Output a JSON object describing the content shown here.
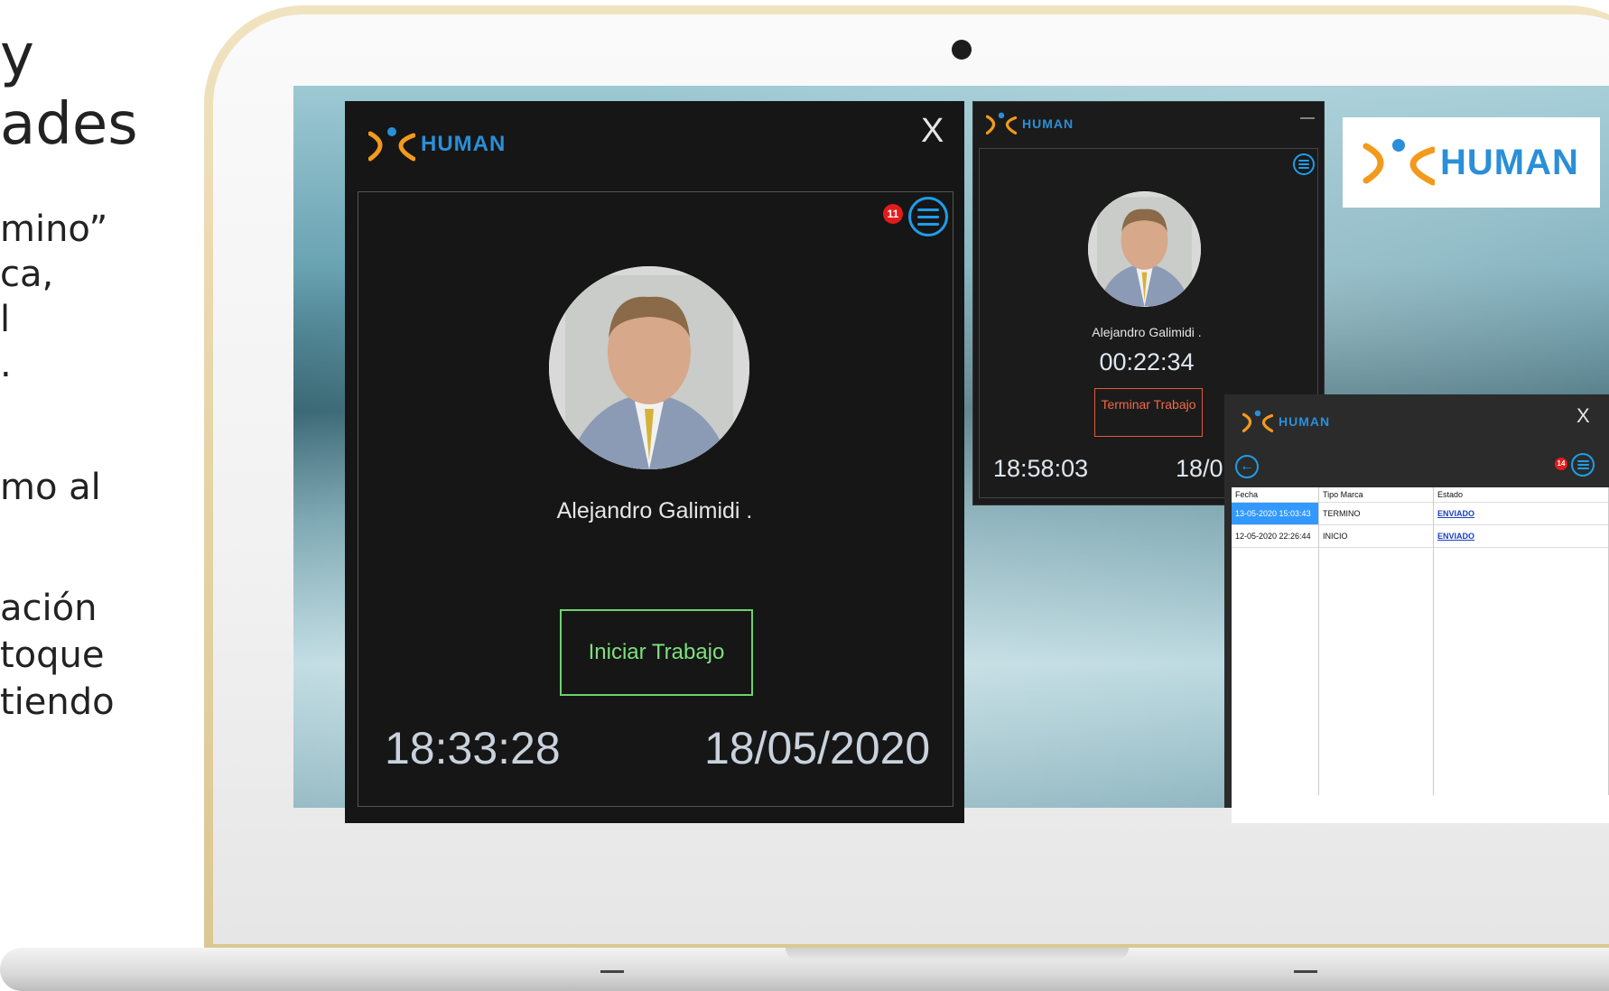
{
  "slide_left": {
    "line1": "y",
    "line2": "ades",
    "line3": "mino”",
    "line4": "ca,",
    "line5": "l",
    "line6": ".",
    "line7": "mo al",
    "line8": "ación",
    "line9": "toque",
    "line10": "tiendo"
  },
  "brand": {
    "name": "HUMAN",
    "colors": {
      "blue": "#2a8fd8",
      "orange": "#f39a1d"
    }
  },
  "main_window": {
    "close_label": "X",
    "notification_count": "11",
    "user_name": "Alejandro Galimidi .",
    "start_button_label": "Iniciar Trabajo",
    "time": "18:33:28",
    "date": "18/05/2020"
  },
  "second_window": {
    "minimize_label": "—",
    "user_name": "Alejandro Galimidi .",
    "elapsed": "00:22:34",
    "stop_button_label": "Terminar Trabajo",
    "time": "18:58:03",
    "date_partial": "18/0"
  },
  "third_window": {
    "close_label": "X",
    "notification_count": "14",
    "table": {
      "headers": [
        "Fecha",
        "Tipo Marca",
        "Estado"
      ],
      "rows": [
        {
          "fecha": "13-05-2020 15:03:43",
          "tipo": "TERMINO",
          "estado": "ENVIADO"
        },
        {
          "fecha": "12-05-2020 22:26:44",
          "tipo": "INICIO",
          "estado": "ENVIADO"
        }
      ]
    }
  },
  "accent_colors": {
    "menu_blue": "#1e9ee8",
    "start_green": "#6bd36b",
    "stop_orange": "#e05a3a",
    "badge_red": "#e51b1b"
  }
}
